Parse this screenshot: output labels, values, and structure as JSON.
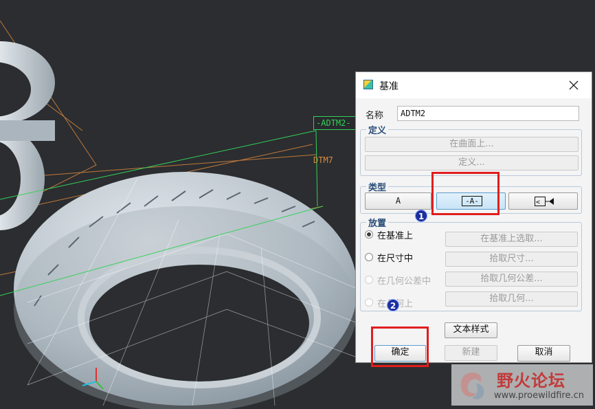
{
  "viewport": {
    "datum_tags": {
      "adtm2": "-ADTM2-",
      "dtm7": "DTM7"
    }
  },
  "dialog": {
    "title": "基准",
    "name_label": "名称",
    "name_value": "ADTM2",
    "definition": {
      "title": "定义",
      "on_surface_button": "在曲面上...",
      "define_button": "定义..."
    },
    "type": {
      "title": "类型",
      "options": [
        {
          "label": "A"
        },
        {
          "label": "-A-",
          "selected": true
        },
        {
          "icon": "angle-datum-icon"
        }
      ]
    },
    "placement": {
      "title": "放置",
      "rows": [
        {
          "radio": "在基准上",
          "selected": true,
          "enabled": true,
          "pick": "在基准上选取..."
        },
        {
          "radio": "在尺寸中",
          "selected": false,
          "enabled": true,
          "pick": "拾取尺寸..."
        },
        {
          "radio": "在几何公差中",
          "selected": false,
          "enabled": false,
          "pick": "拾取几何公差..."
        },
        {
          "radio": "在几何上",
          "selected": false,
          "enabled": false,
          "pick": "拾取几何..."
        }
      ]
    },
    "text_style_button": "文本样式",
    "ok_button": "确定",
    "new_button": "新建",
    "cancel_button": "取消"
  },
  "annotations": {
    "step1": "1",
    "step2": "2"
  },
  "watermark": {
    "name": "野火论坛",
    "url": "www.proewildfire.cn"
  },
  "colors": {
    "highlight_box": "#e11d1d",
    "datum_green": "#34d15a",
    "datum_orange": "#d98a3d",
    "group_title": "#2a4d79"
  }
}
